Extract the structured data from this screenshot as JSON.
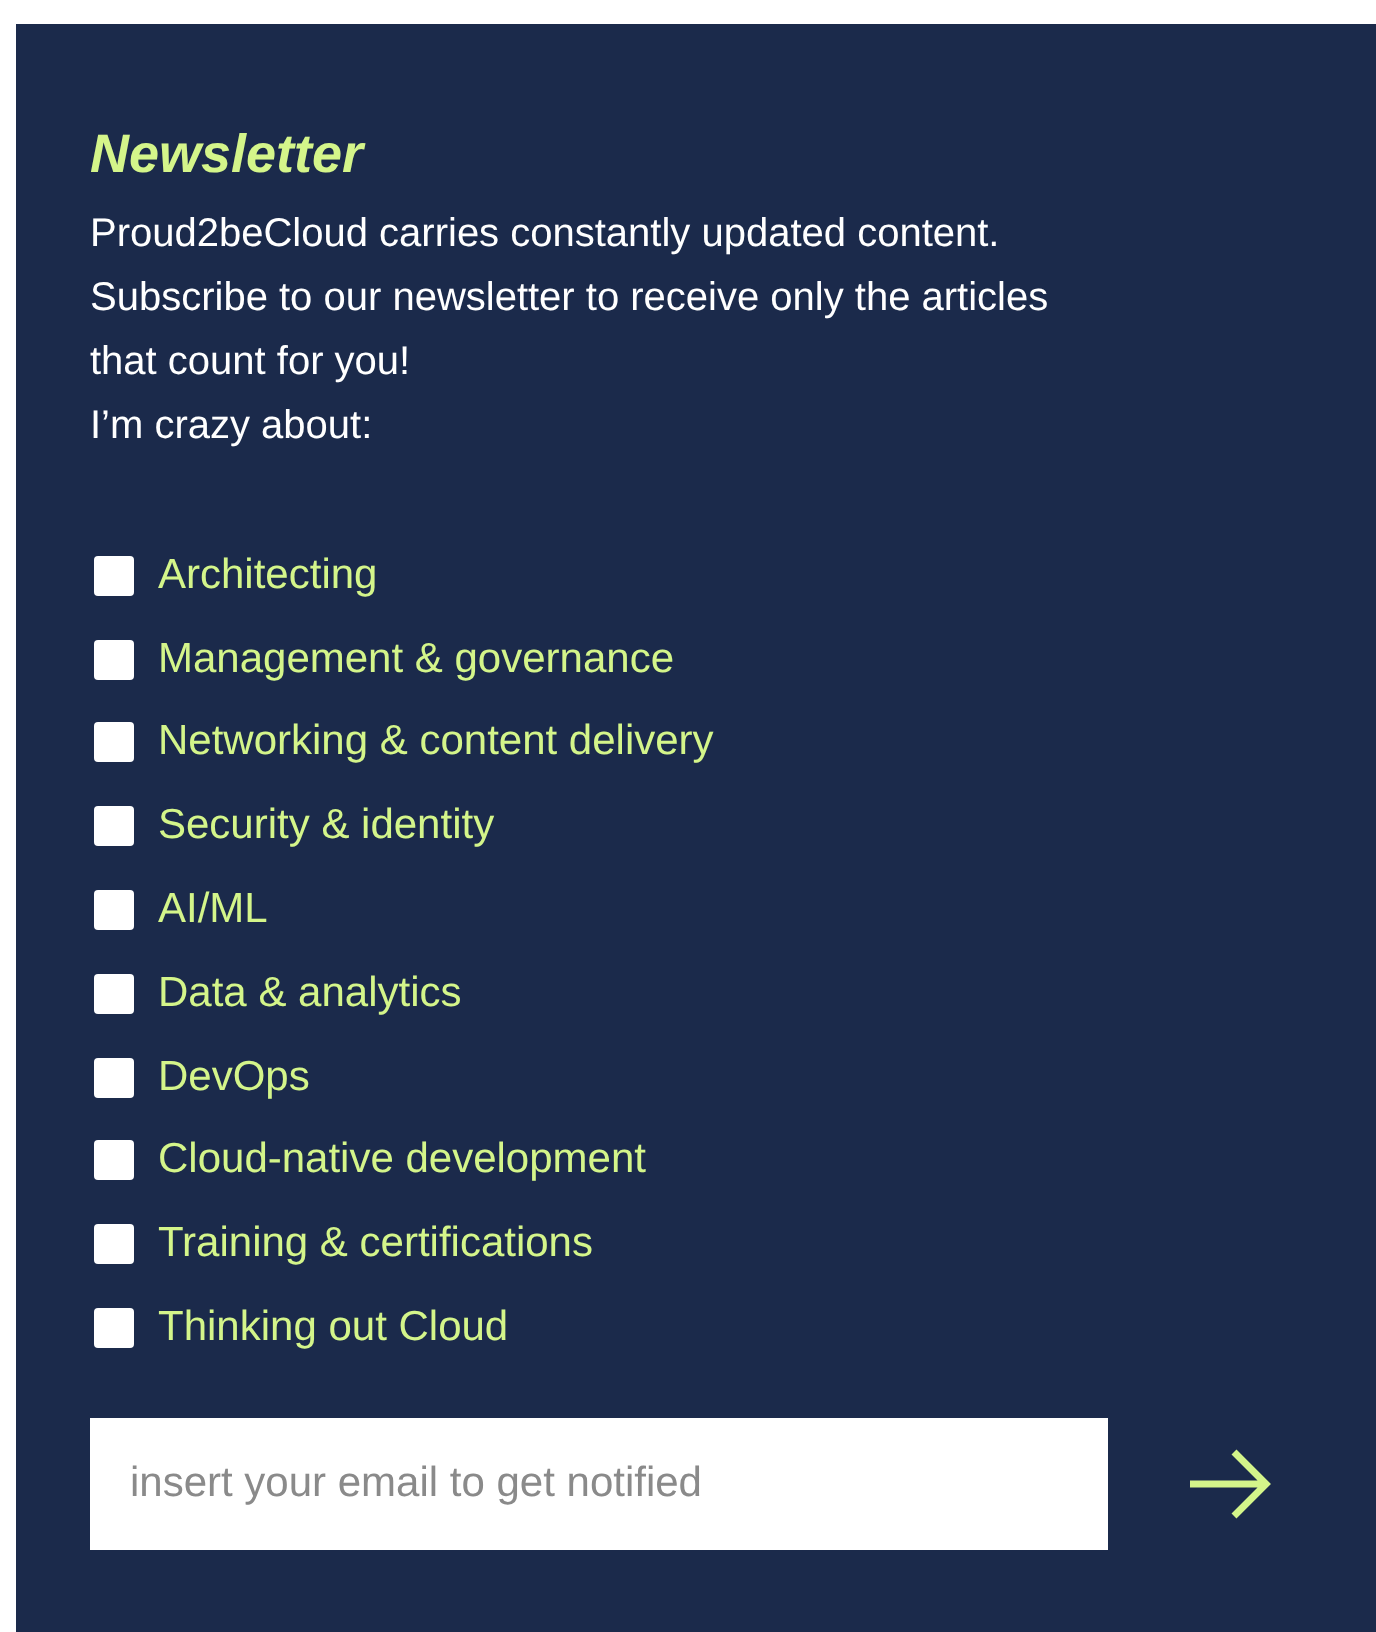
{
  "title": "Newsletter",
  "intro": "Proud2beCloud carries constantly updated content.\nSubscribe to our newsletter to receive only the articles\nthat count for you!",
  "prompt": "I’m crazy about:",
  "topics": [
    {
      "label": "Architecting",
      "checked": false
    },
    {
      "label": "Management & governance",
      "checked": false
    },
    {
      "label": "Networking & content delivery",
      "checked": false
    },
    {
      "label": "Security & identity",
      "checked": false
    },
    {
      "label": "AI/ML",
      "checked": false
    },
    {
      "label": "Data & analytics",
      "checked": false
    },
    {
      "label": "DevOps",
      "checked": false
    },
    {
      "label": "Cloud-native development",
      "checked": false
    },
    {
      "label": "Training & certifications",
      "checked": false
    },
    {
      "label": "Thinking out Cloud",
      "checked": false
    }
  ],
  "email": {
    "placeholder": "insert your email to get notified"
  }
}
